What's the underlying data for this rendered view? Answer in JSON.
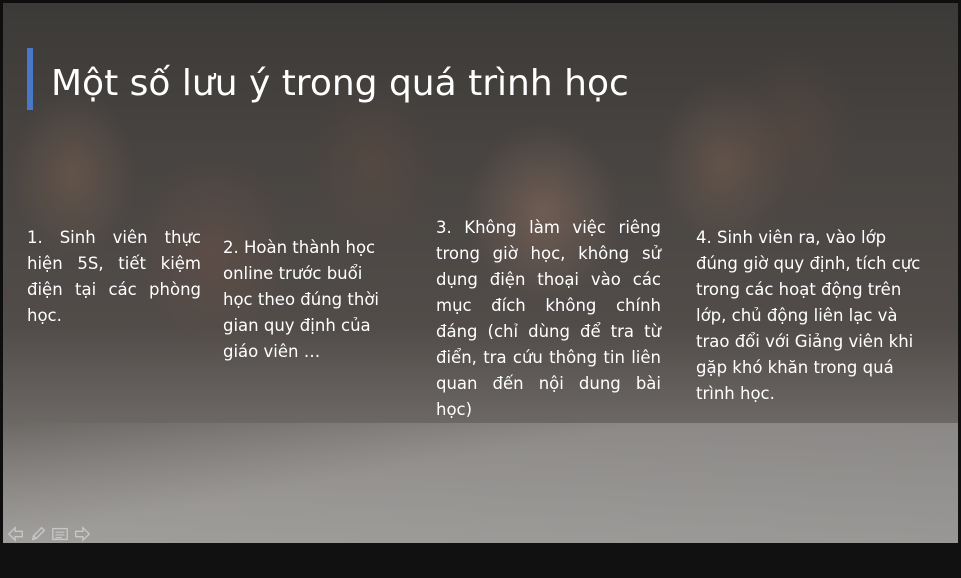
{
  "slide": {
    "title": "Một số lưu ý trong quá trình học",
    "items": [
      "1. Sinh viên thực hiện 5S, tiết kiệm điện tại các phòng học.",
      "2. Hoàn thành học online trước buổi học theo đúng thời gian quy định của giáo viên …",
      "3. Không làm việc riêng trong giờ học, không sử dụng điện thoại vào các mục đích không chính đáng (chỉ dùng để tra từ điển, tra cứu thông tin liên quan đến nội dung bài học)",
      "4. Sinh viên ra, vào lớp đúng giờ quy định, tích cực trong các hoạt động trên lớp, chủ động liên lạc và trao đổi với Giảng viên khi gặp khó khăn trong quá trình học."
    ]
  },
  "colors": {
    "accent": "#4a78c8",
    "text": "#ffffff"
  },
  "nav_icons": [
    "previous-arrow-icon",
    "pen-icon",
    "menu-icon",
    "next-arrow-icon"
  ]
}
